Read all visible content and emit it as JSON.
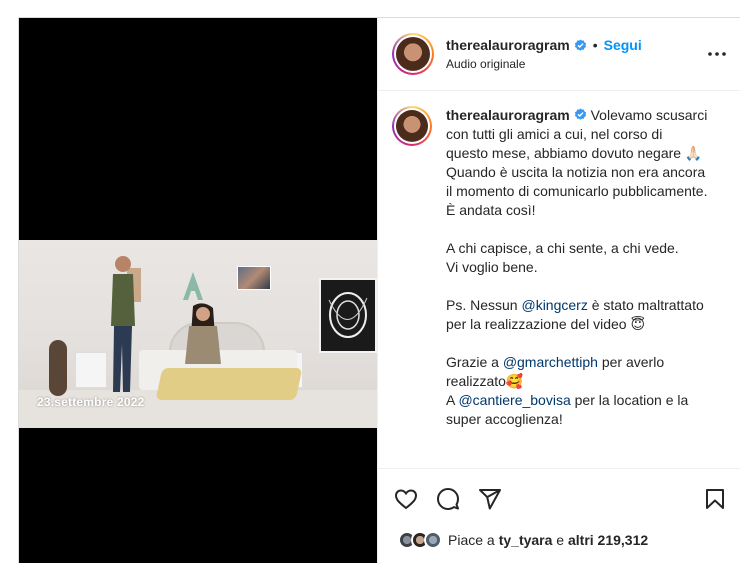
{
  "media": {
    "overlay_text": "23.settembre 2022"
  },
  "header": {
    "username": "therealauroragram",
    "separator": "•",
    "follow_label": "Segui",
    "audio_label": "Audio originale"
  },
  "caption": {
    "username": "therealauroragram",
    "paragraph1": "Volevamo scusarci con tutti gli amici a cui, nel corso di questo mese, abbiamo dovuto negare 🙏🏻Quando è uscita la notizia non era ancora il momento di comunicarlo pubblicamente. È andata così!",
    "paragraph2": "A chi capisce, a chi sente, a chi vede.\nVi voglio bene.",
    "p3_pre": "Ps. Nessun ",
    "p3_mention": "@kingcerz",
    "p3_post": " è stato maltrattato per la realizzazione del video 😇",
    "p4_pre": "Grazie a ",
    "p4_mention": "@gmarchettiph",
    "p4_post": " per averlo realizzato🥰",
    "p5_pre": "A ",
    "p5_mention": "@cantiere_bovisa",
    "p5_post": " per la location e la super accoglienza!"
  },
  "likes": {
    "prefix": "Piace a ",
    "user": "ty_tyara",
    "middle": " e ",
    "others": "altri 219,312"
  },
  "colors": {
    "accent": "#0095f6",
    "mention": "#00376b",
    "verified": "#3897f0"
  },
  "icons": [
    "heart-icon",
    "comment-icon",
    "share-icon",
    "bookmark-icon",
    "more-icon",
    "verified-icon"
  ]
}
